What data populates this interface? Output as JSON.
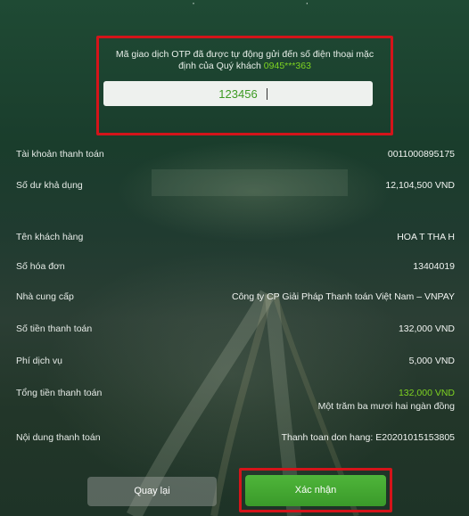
{
  "otp": {
    "message_line1": "Mã giao dịch OTP đã được tự động gửi đến số điện thoại mặc",
    "message_line2_prefix": "định của Quý khách ",
    "phone_masked": "0945***363",
    "input_value": "123456"
  },
  "details": [
    {
      "label": "Tài khoản thanh toán",
      "value": "0011000895175"
    },
    {
      "label": "Số dư khả dụng",
      "value": "12,104,500 VND"
    },
    {
      "label": "Tên khách hàng",
      "value": "HOA T THA H"
    },
    {
      "label": "Số hóa đơn",
      "value": "13404019"
    },
    {
      "label": "Nhà cung cấp",
      "value": "Công ty CP Giải Pháp Thanh toán Việt Nam – VNPAY"
    },
    {
      "label": "Số tiền thanh toán",
      "value": "132,000 VND"
    },
    {
      "label": "Phí dịch vụ",
      "value": "5,000 VND"
    },
    {
      "label": "Tổng tiền thanh toán",
      "value": "132,000 VND",
      "sub": "Một trăm ba mươi hai ngàn đồng"
    },
    {
      "label": "Nội dung thanh toán",
      "value": "Thanh toan don hang: E20201015153805"
    }
  ],
  "buttons": {
    "back_label": "Quay lại",
    "confirm_label": "Xác nhận"
  },
  "colors": {
    "highlight_frame": "#d4141a",
    "accent_green": "#7ed321",
    "confirm_button": "#45a834"
  }
}
